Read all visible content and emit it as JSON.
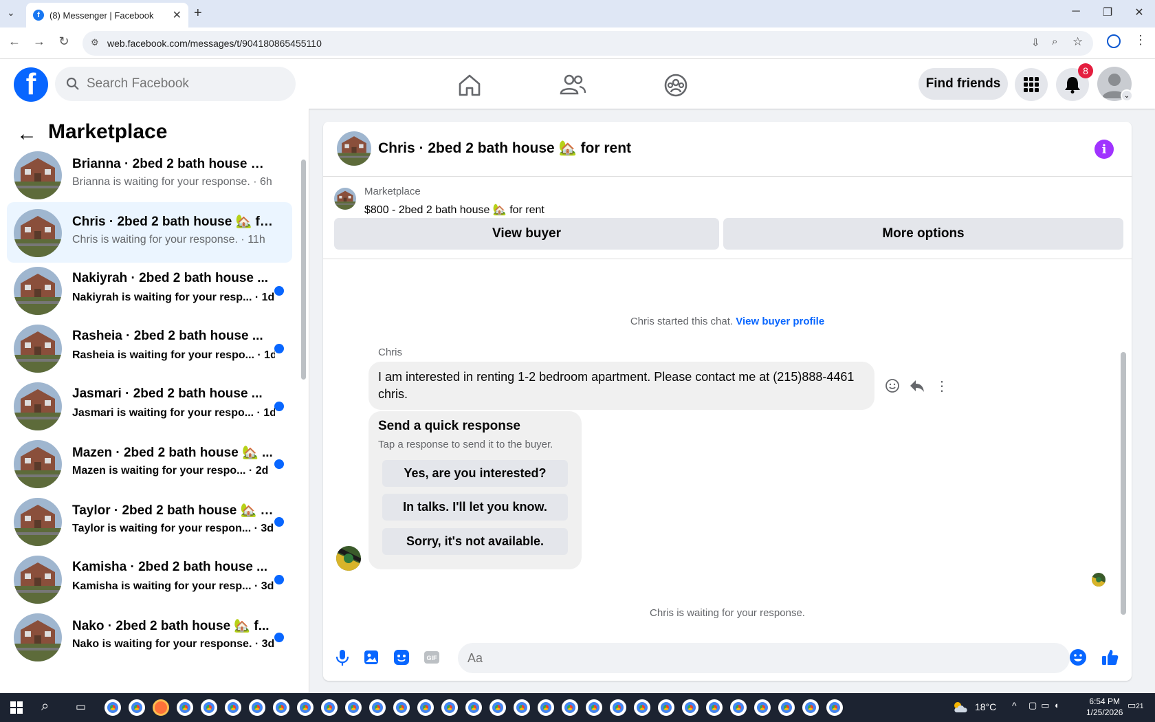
{
  "browser": {
    "tab_title": "(8) Messenger | Facebook",
    "url": "web.facebook.com/messages/t/904180865455110"
  },
  "header": {
    "search_placeholder": "Search Facebook",
    "find_friends_label": "Find friends",
    "notification_count": "8"
  },
  "sidebar": {
    "title": "Marketplace",
    "conversations": [
      {
        "name": "Brianna · 2bed 2 bath house 🏡 f...",
        "preview": "Brianna is waiting for your response. · 6h",
        "unread": false,
        "active": false
      },
      {
        "name": "Chris · 2bed 2 bath house 🏡 for ...",
        "preview": "Chris is waiting for your response. · 11h",
        "unread": false,
        "active": true
      },
      {
        "name": "Nakiyrah · 2bed 2 bath house ...",
        "preview": "Nakiyrah is waiting for your resp... · 1d",
        "unread": true,
        "active": false
      },
      {
        "name": "Rasheia · 2bed 2 bath house ...",
        "preview": "Rasheia is waiting for your respo... · 1d",
        "unread": true,
        "active": false
      },
      {
        "name": "Jasmari · 2bed 2 bath house ...",
        "preview": "Jasmari is waiting for your respo... · 1d",
        "unread": true,
        "active": false
      },
      {
        "name": "Mazen · 2bed 2 bath house 🏡 ...",
        "preview": "Mazen is waiting for your respo... · 2d",
        "unread": true,
        "active": false
      },
      {
        "name": "Taylor · 2bed 2 bath house 🏡 f...",
        "preview": "Taylor is waiting for your respon... · 3d",
        "unread": true,
        "active": false
      },
      {
        "name": "Kamisha · 2bed 2 bath house ...",
        "preview": "Kamisha is waiting for your resp... · 3d",
        "unread": true,
        "active": false
      },
      {
        "name": "Nako · 2bed 2 bath house 🏡 f...",
        "preview": "Nako is waiting for your response. · 3d",
        "unread": true,
        "active": false
      }
    ]
  },
  "chat": {
    "title": "Chris · 2bed 2 bath house 🏡 for rent",
    "marketplace_label": "Marketplace",
    "listing": "$800 - 2bed 2 bath house 🏡 for rent",
    "view_buyer_label": "View buyer",
    "more_options_label": "More options",
    "started_text": "Chris started this chat.",
    "view_buyer_profile_label": "View buyer profile",
    "sender_name": "Chris",
    "message": "I am interested in renting 1-2 bedroom apartment. Please contact me at (215)888-4461 chris.",
    "quick_title": "Send a quick response",
    "quick_subtitle": "Tap a response to send it to the buyer.",
    "quick_responses": [
      "Yes, are you interested?",
      "In talks. I'll let you know.",
      "Sorry, it's not available."
    ],
    "waiting_text": "Chris is waiting for your response.",
    "input_placeholder": "Aa"
  },
  "taskbar": {
    "temperature": "18°C",
    "time": "6:54 PM",
    "date": "1/25/2026",
    "notification_count": "21"
  },
  "colors": {
    "brand": "#0866ff",
    "active_bg": "#ebf5ff",
    "info": "#a033ff"
  }
}
